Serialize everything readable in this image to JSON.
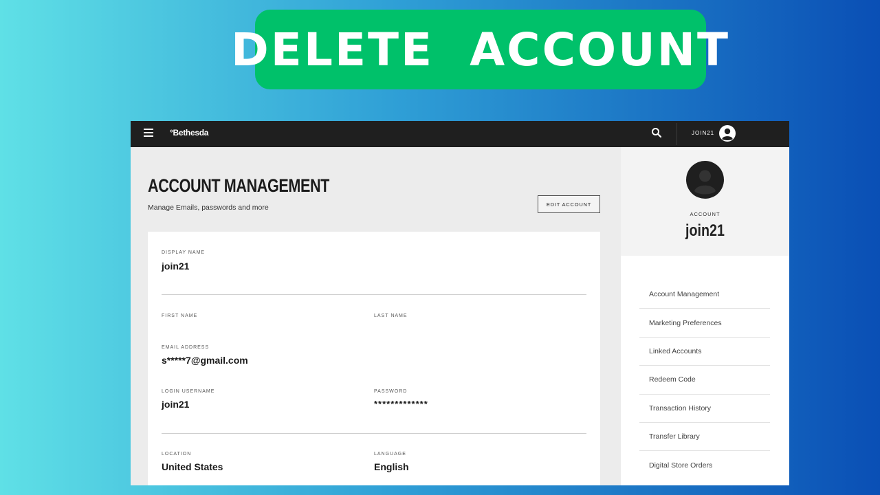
{
  "banner": {
    "text": "DELETE  ACCOUNT",
    "color": "#00c16a"
  },
  "topbar": {
    "brand": "°Bethesda",
    "username": "JOIN21",
    "icons": [
      "menu-icon",
      "search-icon",
      "user-avatar-icon"
    ]
  },
  "main": {
    "title": "ACCOUNT MANAGEMENT",
    "subtitle": "Manage Emails, passwords and more",
    "edit_button": "EDIT ACCOUNT",
    "fields": {
      "display_name": {
        "label": "DISPLAY NAME",
        "value": "join21"
      },
      "first_name": {
        "label": "FIRST NAME",
        "value": ""
      },
      "last_name": {
        "label": "LAST NAME",
        "value": ""
      },
      "email": {
        "label": "EMAIL ADDRESS",
        "value": "s*****7@gmail.com"
      },
      "login_username": {
        "label": "LOGIN USERNAME",
        "value": "join21"
      },
      "password": {
        "label": "PASSWORD",
        "value": "*************"
      },
      "location": {
        "label": "LOCATION",
        "value": "United States"
      },
      "language": {
        "label": "LANGUAGE",
        "value": "English"
      }
    }
  },
  "sidebar": {
    "account_label": "ACCOUNT",
    "account_name": "join21",
    "items": [
      "Account Management",
      "Marketing Preferences",
      "Linked Accounts",
      "Redeem Code",
      "Transaction History",
      "Transfer Library",
      "Digital Store Orders"
    ]
  }
}
